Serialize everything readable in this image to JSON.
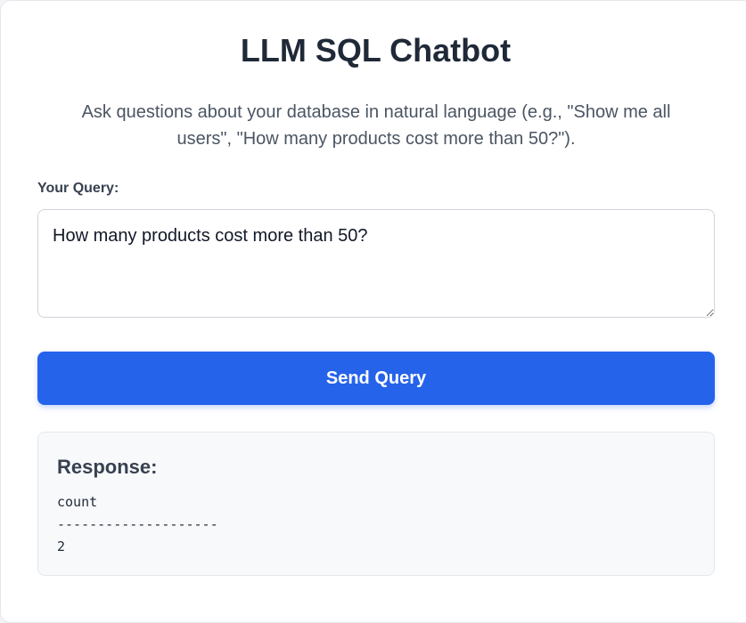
{
  "header": {
    "title": "LLM SQL Chatbot",
    "subtitle": "Ask questions about your database in natural language (e.g., \"Show me all users\", \"How many products cost more than 50?\")."
  },
  "form": {
    "query_label": "Your Query:",
    "query_value": "How many products cost more than 50?",
    "send_label": "Send Query"
  },
  "response": {
    "heading": "Response:",
    "output": "count\n--------------------\n2"
  },
  "colors": {
    "accent": "#2563eb",
    "title_text": "#1f2937",
    "subtitle_text": "#4b5563",
    "response_background": "#f8f9fb"
  }
}
